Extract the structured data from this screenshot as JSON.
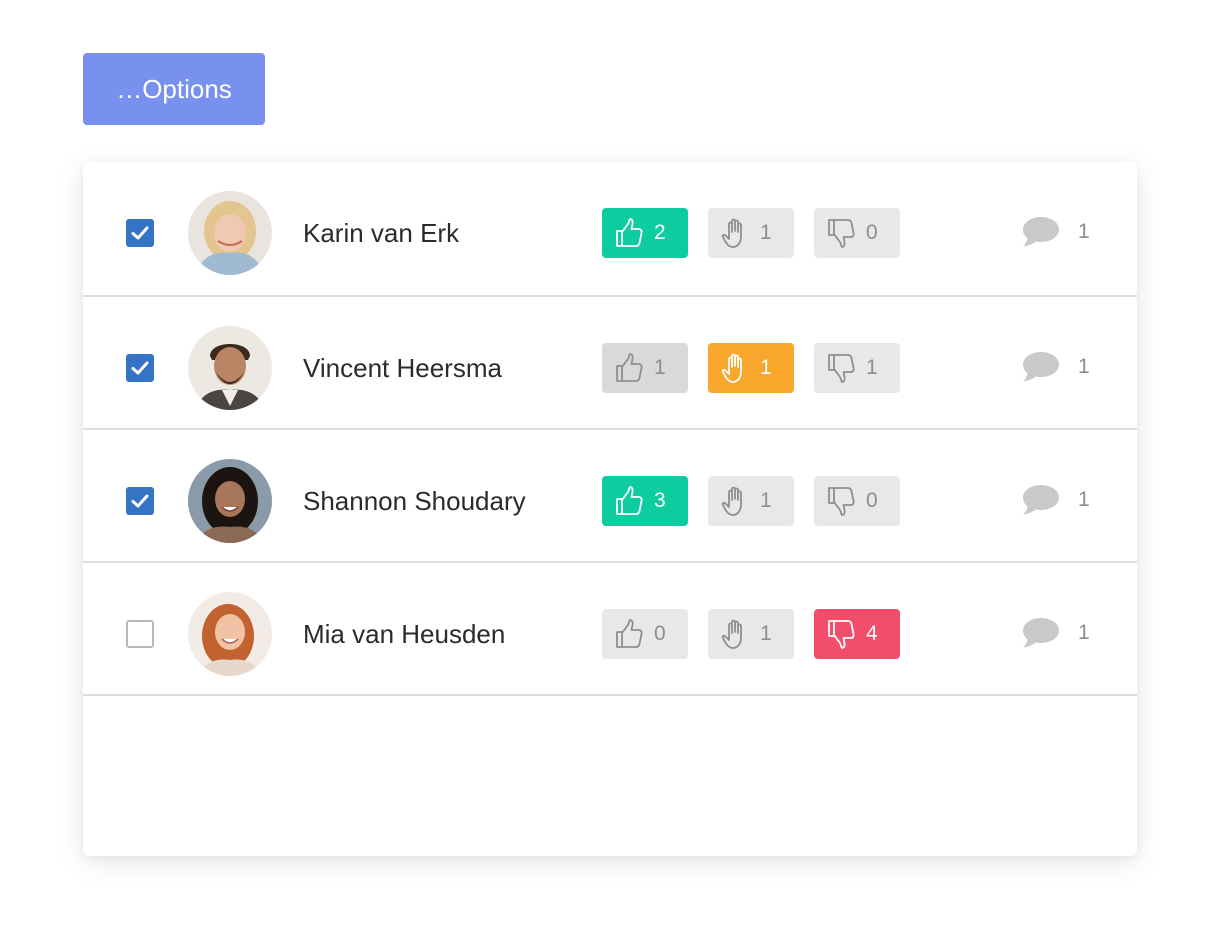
{
  "toolbar": {
    "options_label": "…Options"
  },
  "colors": {
    "options": "#7891ee",
    "checked": "#3574c4",
    "up_active": "#0ccca0",
    "hand_active": "#f9a62c",
    "down_active": "#f34d6c",
    "inactive": "#e8e8e8",
    "text_muted": "#8e8e8e"
  },
  "participants": [
    {
      "name": "Karin van Erk",
      "checked": true,
      "avatar": "avatar-photo",
      "votes": {
        "up": "2",
        "hand": "1",
        "down": "0"
      },
      "active": "up",
      "comments": "1"
    },
    {
      "name": "Vincent Heersma",
      "checked": true,
      "avatar": "avatar-photo",
      "votes": {
        "up": "1",
        "hand": "1",
        "down": "1"
      },
      "active": "hand",
      "comments": "1"
    },
    {
      "name": "Shannon Shoudary",
      "checked": true,
      "avatar": "avatar-photo",
      "votes": {
        "up": "3",
        "hand": "1",
        "down": "0"
      },
      "active": "up",
      "comments": "1"
    },
    {
      "name": "Mia van Heusden",
      "checked": false,
      "avatar": "avatar-photo",
      "votes": {
        "up": "0",
        "hand": "1",
        "down": "4"
      },
      "active": "down",
      "comments": "1"
    }
  ],
  "icons": {
    "up": "thumbs-up-icon",
    "hand": "raised-hand-icon",
    "down": "thumbs-down-icon",
    "comment": "comment-bubble-icon",
    "check": "checkmark-icon"
  }
}
